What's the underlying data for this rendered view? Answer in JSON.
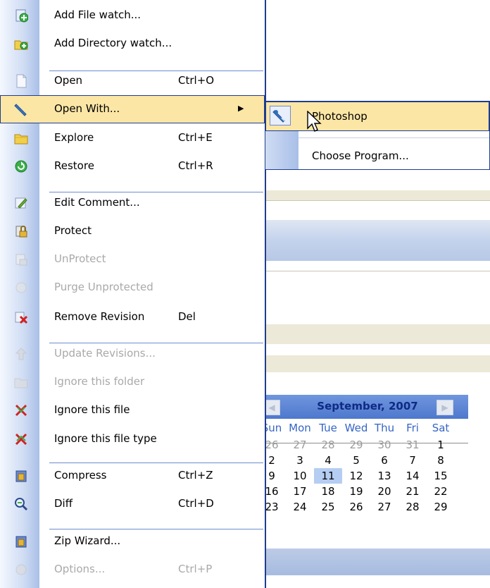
{
  "menu": {
    "items": [
      {
        "label": "Add File watch...",
        "shortcut": "",
        "icon": "add-file-icon"
      },
      {
        "label": "Add Directory watch...",
        "shortcut": "",
        "icon": "add-directory-icon"
      },
      {
        "label": "Open",
        "shortcut": "Ctrl+O",
        "icon": "document-icon"
      },
      {
        "label": "Open With...",
        "shortcut": "",
        "icon": "open-with-icon",
        "highlighted": true,
        "has_submenu": true
      },
      {
        "label": "Explore",
        "shortcut": "Ctrl+E",
        "icon": "folder-icon"
      },
      {
        "label": "Restore",
        "shortcut": "Ctrl+R",
        "icon": "restore-icon"
      },
      {
        "label": "Edit Comment...",
        "shortcut": "",
        "icon": "edit-comment-icon"
      },
      {
        "label": "Protect",
        "shortcut": "",
        "icon": "protect-icon"
      },
      {
        "label": "UnProtect",
        "shortcut": "",
        "icon": "unprotect-icon",
        "disabled": true
      },
      {
        "label": "Purge Unprotected",
        "shortcut": "",
        "icon": "purge-icon",
        "disabled": true
      },
      {
        "label": "Remove Revision",
        "shortcut": "Del",
        "icon": "remove-revision-icon"
      },
      {
        "label": "Update Revisions...",
        "shortcut": "",
        "icon": "update-revisions-icon",
        "disabled": true
      },
      {
        "label": "Ignore this folder",
        "shortcut": "",
        "icon": "ignore-folder-icon",
        "disabled": true
      },
      {
        "label": "Ignore this file",
        "shortcut": "",
        "icon": "ignore-file-icon"
      },
      {
        "label": "Ignore this file type",
        "shortcut": "",
        "icon": "ignore-file-type-icon"
      },
      {
        "label": "Compress",
        "shortcut": "Ctrl+Z",
        "icon": "compress-icon"
      },
      {
        "label": "Diff",
        "shortcut": "Ctrl+D",
        "icon": "diff-icon"
      },
      {
        "label": "Zip Wizard...",
        "shortcut": "",
        "icon": "zip-wizard-icon"
      },
      {
        "label": "Options...",
        "shortcut": "Ctrl+P",
        "icon": "options-icon",
        "disabled": true
      }
    ]
  },
  "submenu": {
    "items": [
      {
        "label": "Photoshop",
        "icon": "photoshop-icon",
        "highlighted": true
      },
      {
        "label": "Choose Program...",
        "icon": ""
      }
    ]
  },
  "calendar": {
    "title": "September, 2007",
    "prev_icon": "chevron-left-icon",
    "next_icon": "chevron-right-icon",
    "days_of_week": [
      "Sun",
      "Mon",
      "Tue",
      "Wed",
      "Thu",
      "Fri",
      "Sat"
    ],
    "weeks": [
      [
        "26",
        "27",
        "28",
        "29",
        "30",
        "31",
        "1"
      ],
      [
        "2",
        "3",
        "4",
        "5",
        "6",
        "7",
        "8"
      ],
      [
        "9",
        "10",
        "11",
        "12",
        "13",
        "14",
        "15"
      ],
      [
        "16",
        "17",
        "18",
        "19",
        "20",
        "21",
        "22"
      ],
      [
        "23",
        "24",
        "25",
        "26",
        "27",
        "28",
        "29"
      ]
    ],
    "selected_day": "11",
    "accent": "#4e78cd"
  },
  "colors": {
    "menu_highlight": "#fbe6a6",
    "menu_border": "#1f3d8e",
    "separator": "#6e8bd1"
  }
}
